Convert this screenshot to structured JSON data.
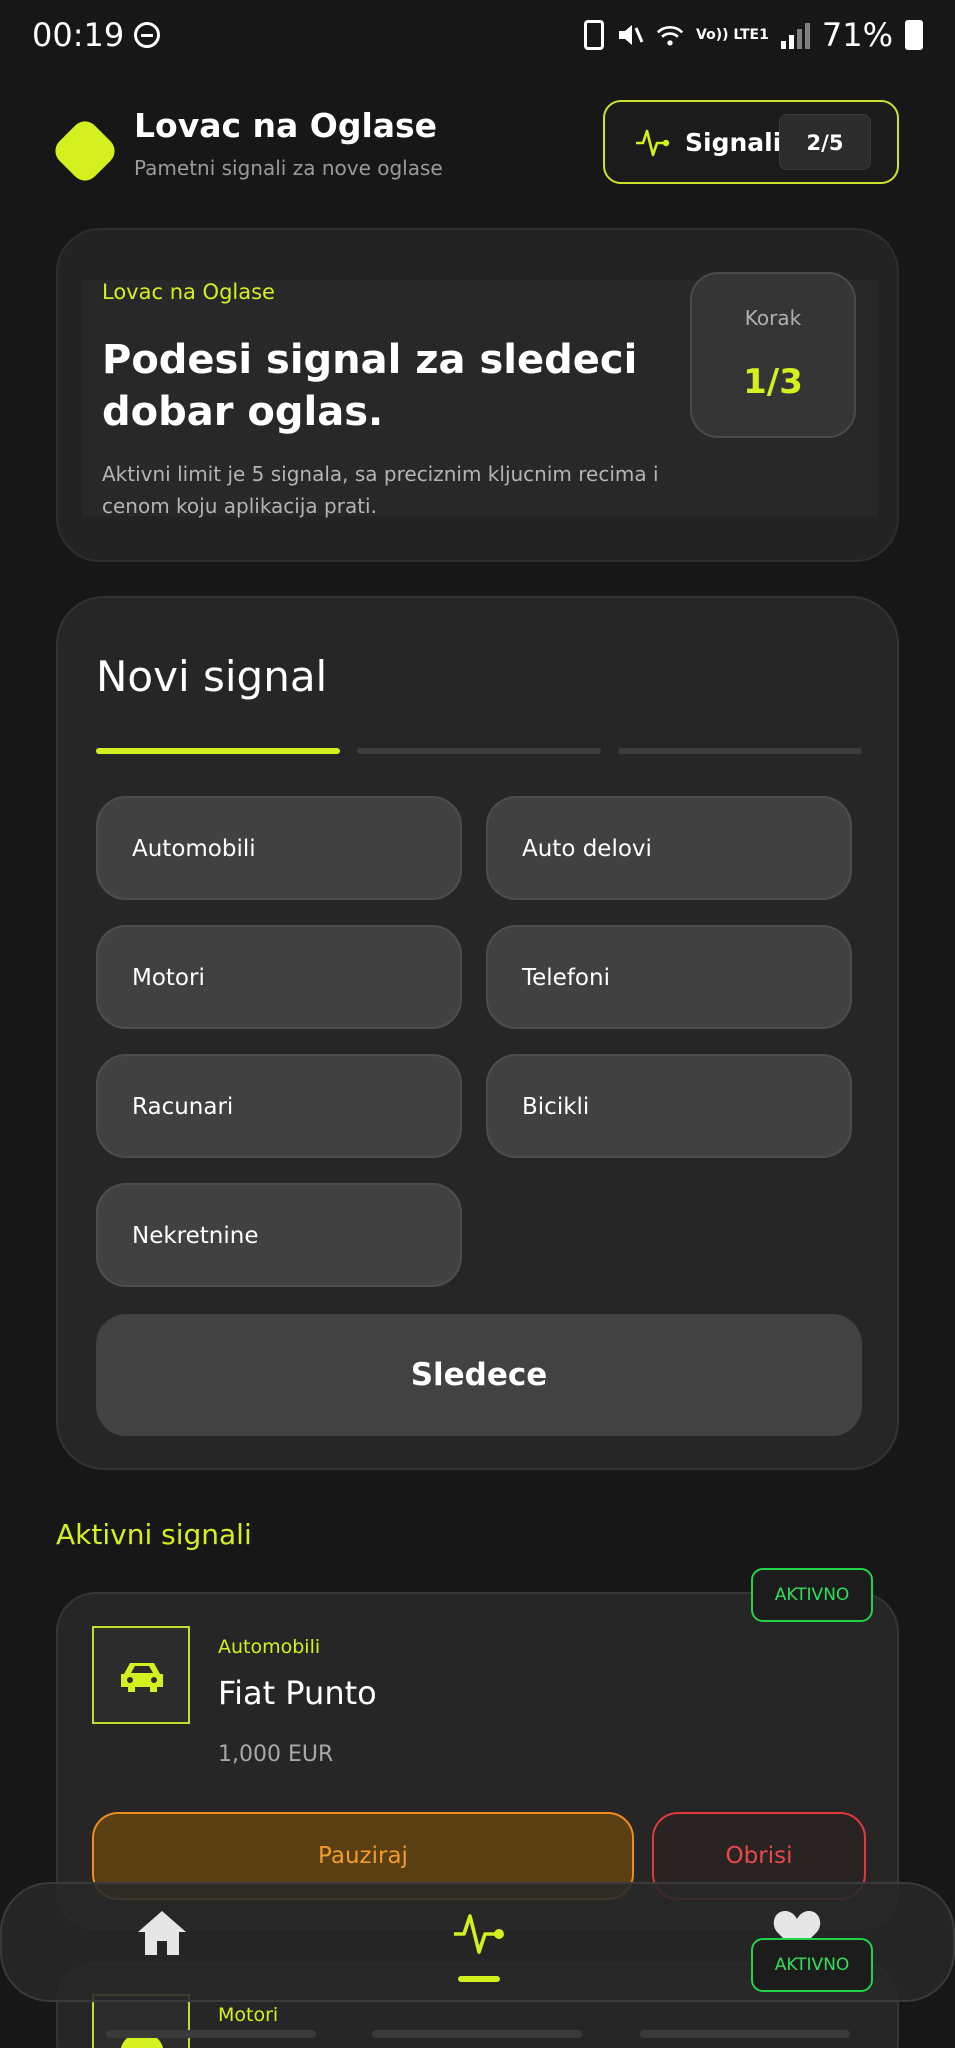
{
  "status_bar": {
    "time": "00:19",
    "network": "Vo)) LTE1",
    "battery": "71%"
  },
  "header": {
    "title": "Lovac na Oglase",
    "subtitle": "Pametni signali za nove oglase",
    "signals_label": "Signali",
    "signals_count": "2/5",
    "accent_color": "#d4f01e"
  },
  "hero": {
    "eyebrow": "Lovac na Oglase",
    "title": "Podesi signal za sledeci dobar oglas.",
    "description": "Aktivni limit je 5 signala, sa preciznim kljucnim recima i cenom koju aplikacija prati.",
    "step_label": "Korak",
    "step_value": "1/3"
  },
  "new_signal": {
    "title": "Novi signal",
    "progress": {
      "current_step": 1,
      "total_steps": 3
    },
    "categories": [
      "Automobili",
      "Auto delovi",
      "Motori",
      "Telefoni",
      "Racunari",
      "Bicikli",
      "Nekretnine"
    ],
    "next_label": "Sledece"
  },
  "active_signals": {
    "title": "Aktivni signali",
    "items": [
      {
        "category": "Automobili",
        "name": "Fiat Punto",
        "price": "1,000 EUR",
        "status": "AKTIVNO",
        "icon": "car-icon",
        "pause_label": "Pauziraj",
        "delete_label": "Obrisi"
      },
      {
        "category": "Motori",
        "status": "AKTIVNO",
        "icon": "speedometer-icon"
      }
    ]
  },
  "bottom_nav": {
    "items": [
      {
        "icon": "home-icon"
      },
      {
        "icon": "pulse-icon",
        "active": true
      },
      {
        "icon": "heart-icon"
      }
    ]
  }
}
